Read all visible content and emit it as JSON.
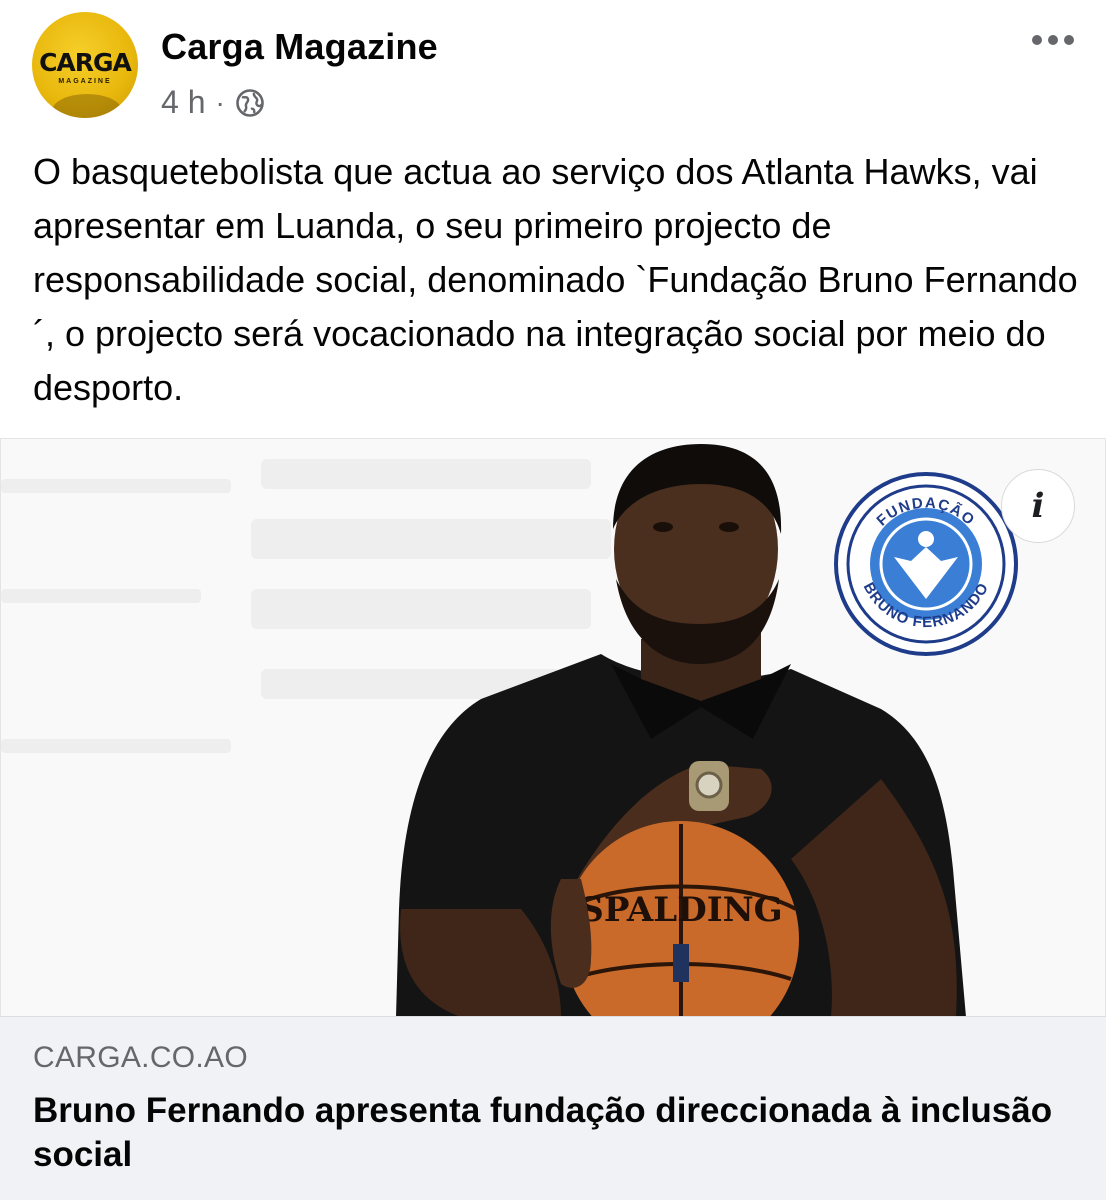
{
  "header": {
    "page_name": "Carga Magazine",
    "avatar_text": "CARGA",
    "avatar_subtext": "MAGAZINE",
    "timestamp": "4 h",
    "separator": "·",
    "privacy_icon": "globe-icon",
    "more_icon": "more-horizontal-icon"
  },
  "post": {
    "text": "O basquetebolista que actua ao serviço dos Atlanta Hawks, vai apresentar em Luanda, o seu primeiro projecto de responsabilidade social, denominado `Fundação Bruno Fernando´, o projecto será vocacionado na integração social por meio do desporto."
  },
  "link_preview": {
    "image": {
      "logo_top_text": "FUNDAÇÃO",
      "logo_bottom_text": "BRUNO FERNANDO",
      "ball_text": "SPALDING"
    },
    "info_icon": "info-icon",
    "info_label": "i",
    "domain": "CARGA.CO.AO",
    "title": "Bruno Fernando apresenta fundação direccionada à inclusão social"
  },
  "colors": {
    "text_primary": "#050505",
    "text_secondary": "#65676b",
    "card_footer_bg": "#f0f2f5",
    "avatar_yellow": "#e8b70c",
    "logo_blue": "#1f3c8a",
    "logo_light_blue": "#3a7fd5"
  }
}
